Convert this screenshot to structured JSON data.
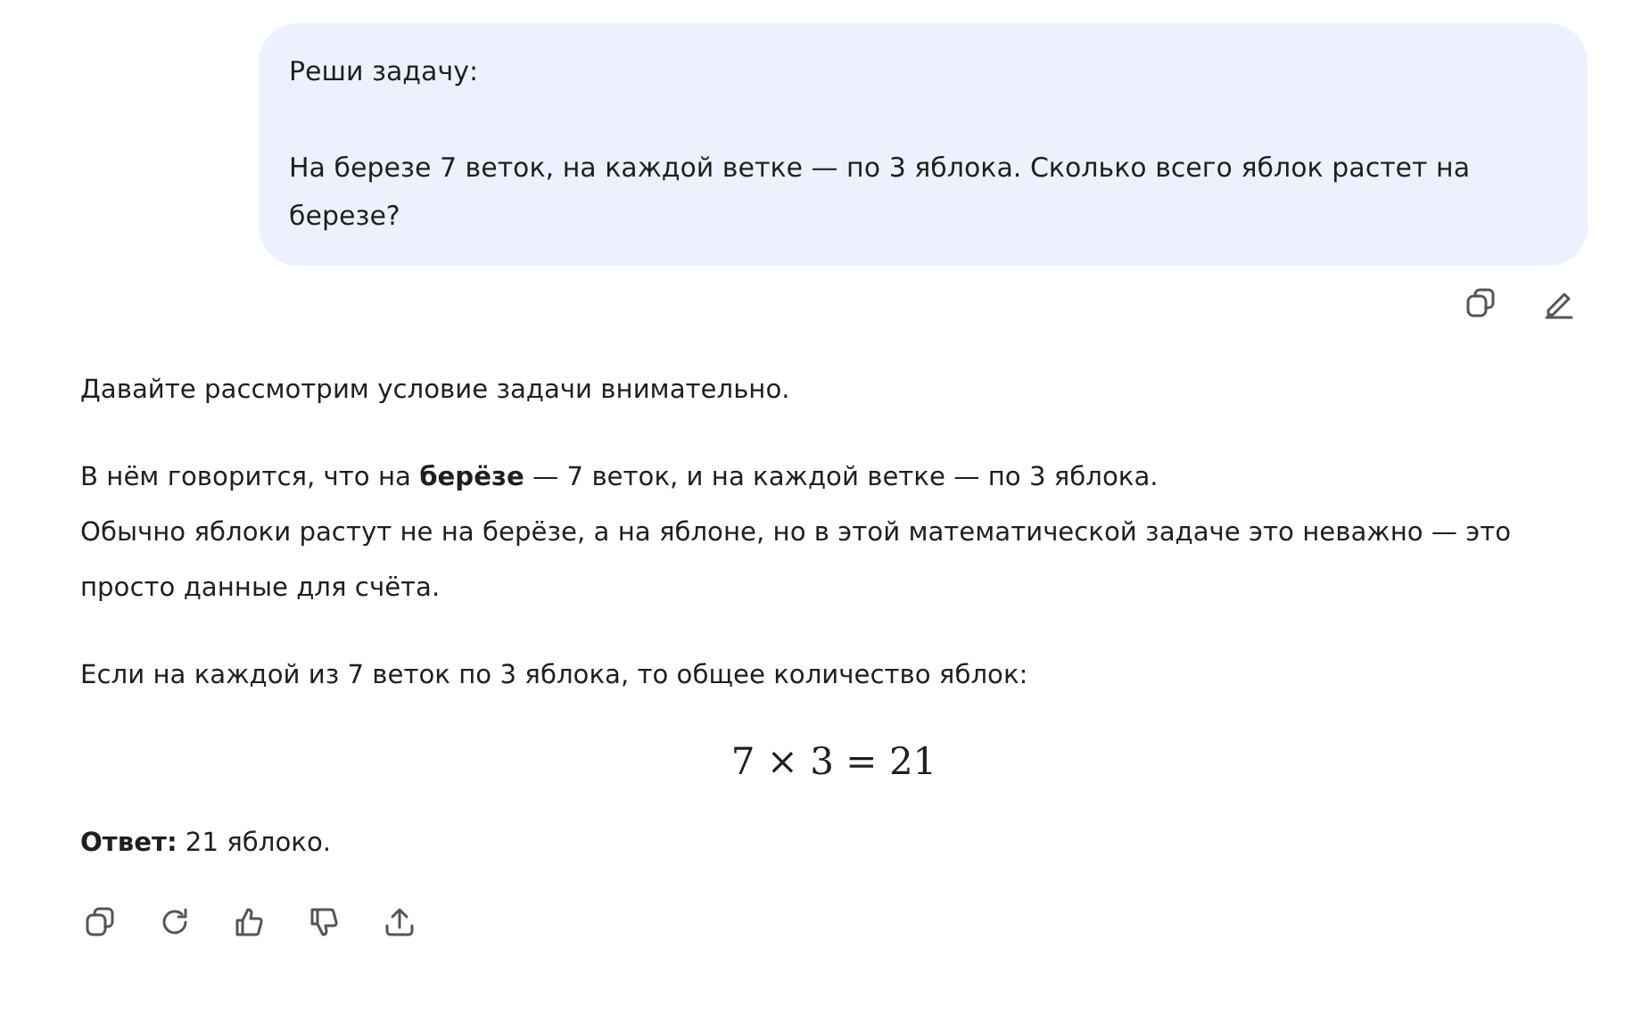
{
  "user_message": {
    "paragraphs": [
      "Реши задачу:",
      "На березе 7 веток, на каждой ветке — по 3 яблока. Сколько всего яблок растет на березе?"
    ]
  },
  "assistant_message": {
    "blocks": [
      {
        "kind": "text",
        "lines": [
          "Давайте рассмотрим условие задачи внимательно."
        ]
      },
      {
        "kind": "text",
        "lines": [
          "В нём говорится, что на **берёзе** — 7 веток, и на каждой ветке — по 3 яблока.",
          "Обычно яблоки растут не на берёзе, а на яблоне, но в этой математической задаче это неважно — это просто данные для счёта."
        ]
      },
      {
        "kind": "text",
        "lines": [
          "Если на каждой из 7 веток по 3 яблока, то общее количество яблок:"
        ]
      },
      {
        "kind": "formula",
        "text": "7 × 3 = 21"
      },
      {
        "kind": "text",
        "lines": [
          "**Ответ:** 21 яблоко."
        ]
      }
    ]
  }
}
